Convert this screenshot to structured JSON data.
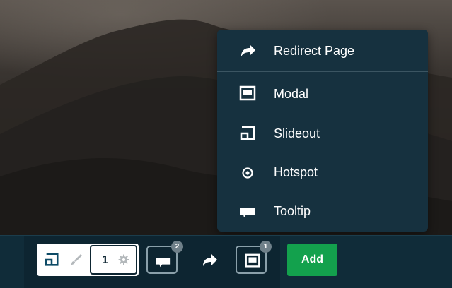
{
  "menu": {
    "items": [
      {
        "label": "Redirect Page",
        "icon": "redirect-arrow-icon"
      },
      {
        "label": "Modal",
        "icon": "modal-icon"
      },
      {
        "label": "Slideout",
        "icon": "slideout-icon"
      },
      {
        "label": "Hotspot",
        "icon": "hotspot-icon"
      },
      {
        "label": "Tooltip",
        "icon": "tooltip-icon"
      }
    ]
  },
  "toolbar": {
    "step_number": "1",
    "tooltip_badge": "2",
    "modal_badge": "1",
    "add_label": "Add"
  },
  "colors": {
    "menu_bg": "#16313f",
    "toolbar_bg": "#102c39",
    "add_button": "#13a14d",
    "badge": "#6f8089"
  }
}
